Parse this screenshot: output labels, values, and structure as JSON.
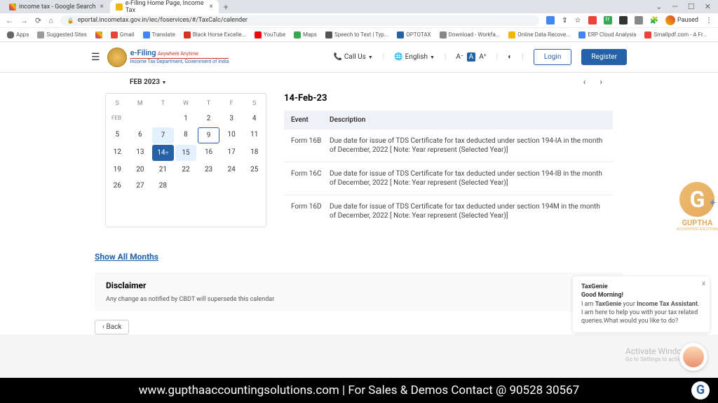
{
  "browser": {
    "tabs": [
      {
        "title": "income tax - Google Search",
        "active": false
      },
      {
        "title": "e-Filing Home Page, Income Tax",
        "active": true
      }
    ],
    "url": "eportal.incometax.gov.in/iec/foservices/#/TaxCalc/calender",
    "paused": "Paused"
  },
  "bookmarks": {
    "apps": "Apps",
    "suggested": "Suggested Sites",
    "gmail": "Gmail",
    "translate": "Translate",
    "blackhorse": "Black Horse Excelle...",
    "youtube": "YouTube",
    "maps": "Maps",
    "speech": "Speech to Text | Typ...",
    "optotax": "OPTOTAX",
    "workfa": "Download - Workfa...",
    "onlinedata": "Online Data Recove...",
    "erpcloud": "ERP Cloud Analysis",
    "smallpdf": "Smallpdf.com - A Fr..."
  },
  "header": {
    "efiling": "e-Filing",
    "anywhere": "Anywhere Anytime",
    "dept": "Income Tax Department, Government of India",
    "callus": "Call Us",
    "english": "English",
    "login": "Login",
    "register": "Register"
  },
  "calendar": {
    "month_label": "FEB 2023",
    "days": [
      "S",
      "M",
      "T",
      "W",
      "T",
      "F",
      "S"
    ],
    "feb_label": "FEB",
    "selected_day": "14",
    "highlighted_day": "7",
    "outlined_day": "9",
    "highlighted_day2": "15",
    "weeks": [
      [
        "",
        "",
        "",
        "1",
        "2",
        "3",
        "4"
      ],
      [
        "5",
        "6",
        "7",
        "8",
        "9",
        "10",
        "11"
      ],
      [
        "12",
        "13",
        "14",
        "15",
        "16",
        "17",
        "18"
      ],
      [
        "19",
        "20",
        "21",
        "22",
        "23",
        "24",
        "25"
      ],
      [
        "26",
        "27",
        "28",
        "",
        "",
        "",
        ""
      ]
    ]
  },
  "events": {
    "date": "14-Feb-23",
    "header_event": "Event",
    "header_desc": "Description",
    "rows": [
      {
        "event": "Form 16B",
        "desc": "Due date for issue of TDS Certificate for tax deducted under section 194-IA in the month of December, 2022 [ Note: Year represent (Selected Year)]"
      },
      {
        "event": "Form 16C",
        "desc": "Due date for issue of TDS Certificate for tax deducted under section 194-IB in the month of December, 2022 [ Note: Year represent (Selected Year)]"
      },
      {
        "event": "Form 16D",
        "desc": "Due date for issue of TDS Certificate for tax deducted under section 194M in the month of December, 2022 [ Note: Year represent (Selected Year)]"
      }
    ]
  },
  "watermark": {
    "text": "GUPTHA",
    "sub": "ACCOUNTING SOLUTIONS"
  },
  "links": {
    "show_all": "Show All Months"
  },
  "disclaimer": {
    "title": "Disclaimer",
    "text": "Any change as notified by CBDT will supersede this calendar"
  },
  "back": "Back",
  "taxgenie": {
    "title": "TaxGenie",
    "greeting": "Good Morning!",
    "body_pre": "I am ",
    "body_bold1": "TaxGenie",
    "body_mid": " your ",
    "body_bold2": "Income Tax Assistant",
    "body_post": ". I am here to help you with your tax related queries.What would you like to do?"
  },
  "activate": {
    "title": "Activate Windows",
    "sub": "Go to Settings to activate Windo"
  },
  "footer": {
    "text": "www.gupthaaccountingsolutions.com | For Sales & Demos Contact @ 90528 30567"
  }
}
